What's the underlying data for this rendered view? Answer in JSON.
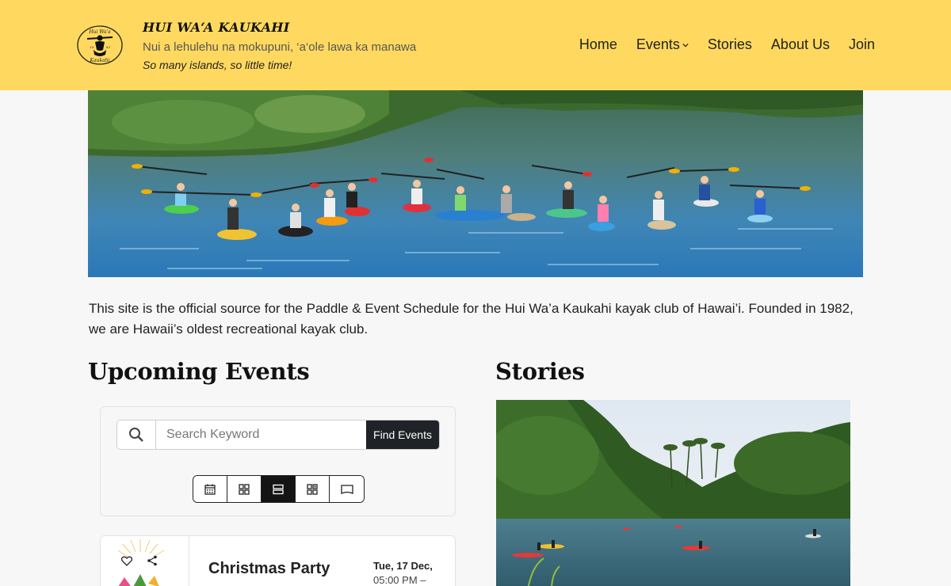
{
  "header": {
    "title": "HUI WA‘A KAUKAHI",
    "tagline_hawaiian": "Nui a lehulehu na mokupuni, ‘a‘ole lawa ka manawa",
    "tagline_english": "So many islands, so little time!",
    "logo_text_top": "Hui Wa'a",
    "logo_text_bottom": "Kaukahi",
    "logo_year": "1982"
  },
  "nav": {
    "items": [
      {
        "label": "Home"
      },
      {
        "label": "Events"
      },
      {
        "label": "Stories"
      },
      {
        "label": "About Us"
      },
      {
        "label": "Join"
      }
    ]
  },
  "intro": "This site is the official source for the Paddle & Event Schedule for the Hui Wa’a Kaukahi kayak club of Hawai’i. Founded in 1982, we are Hawaii’s oldest recreational kayak club.",
  "events": {
    "heading": "Upcoming Events",
    "search_placeholder": "Search Keyword",
    "find_button": "Find Events",
    "views": [
      "calendar-icon",
      "grid-icon",
      "list-icon",
      "tile-icon",
      "map-icon"
    ],
    "active_view": "list-icon",
    "items": [
      {
        "title": "Christmas Party",
        "date": "Tue, 17 Dec,",
        "time": "05:00 PM –"
      }
    ]
  },
  "stories": {
    "heading": "Stories"
  },
  "colors": {
    "header_bg": "#ffd95f",
    "button_dark": "#1f2226",
    "page_bg": "#f7f7f7"
  }
}
